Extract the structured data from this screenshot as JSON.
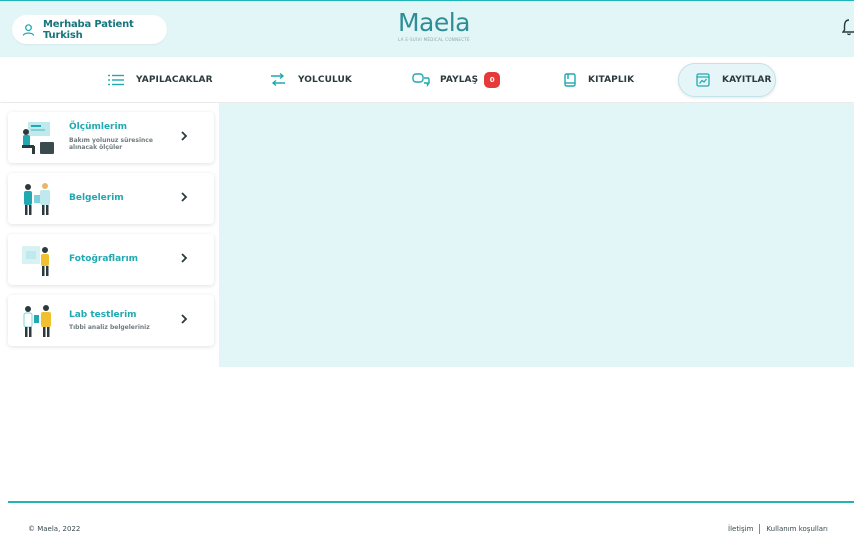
{
  "header": {
    "greeting": "Merhaba Patient Turkish",
    "logo_text": "Maela",
    "logo_tagline": "LA E-SUIVI MÉDICAL CONNECTÉ"
  },
  "nav": {
    "items": [
      {
        "label": "YAPILACAKLAR",
        "icon": "list-icon"
      },
      {
        "label": "YOLCULUK",
        "icon": "route-icon"
      },
      {
        "label": "PAYLAŞ",
        "icon": "chat-icon",
        "badge": "0"
      },
      {
        "label": "KITAPLIK",
        "icon": "book-icon"
      },
      {
        "label": "KAYITLAR",
        "icon": "records-icon",
        "active": true
      }
    ]
  },
  "sidebar": {
    "cards": [
      {
        "title": "Ölçümlerim",
        "subtitle": "Bakım yolunuz süresince alınacak ölçüler"
      },
      {
        "title": "Belgelerim",
        "subtitle": ""
      },
      {
        "title": "Fotoğraflarım",
        "subtitle": ""
      },
      {
        "title": "Lab testlerim",
        "subtitle": "Tıbbi analiz belgeleriniz"
      }
    ]
  },
  "footer": {
    "copyright": "© Maela, 2022",
    "links": [
      "İletişim",
      "Kullanım koşulları"
    ]
  },
  "colors": {
    "accent": "#20b4b6",
    "header_bg": "#e3f6f7",
    "badge": "#e53a3a"
  }
}
